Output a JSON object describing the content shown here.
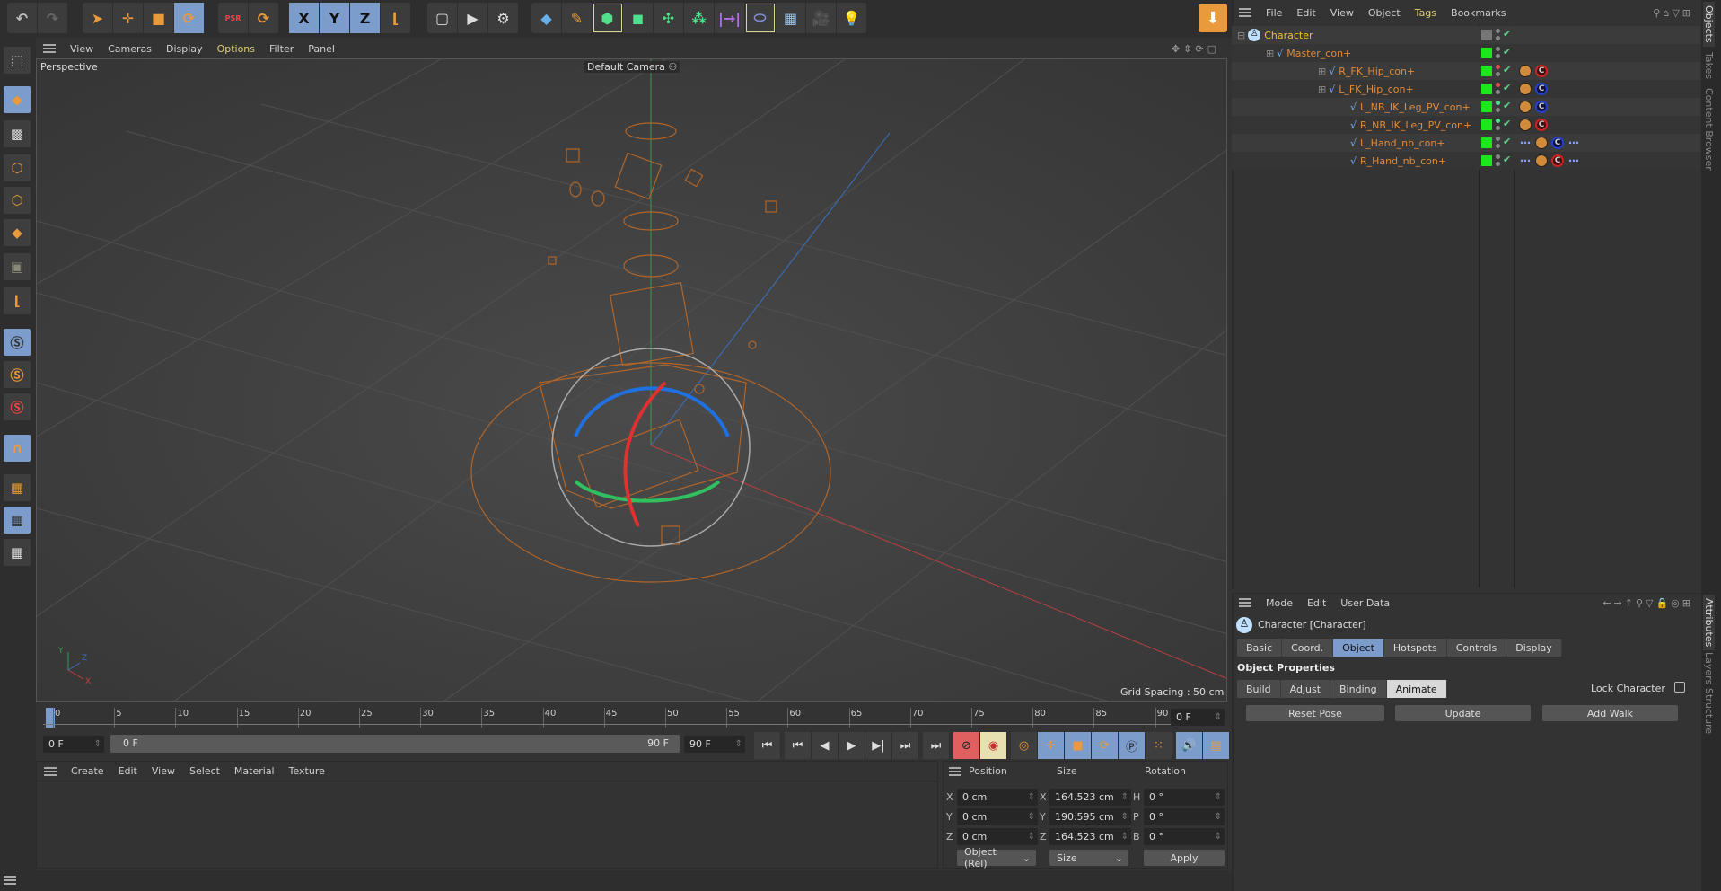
{
  "toolbar": {
    "icons": [
      "undo-icon",
      "redo-icon",
      "select-icon",
      "move-icon",
      "scale-icon",
      "rotate-icon",
      "psr-icon",
      "recent-tool-icon",
      "x-axis-icon",
      "y-axis-icon",
      "z-axis-icon",
      "coordinate-system-icon",
      "render-view-icon",
      "render-picture-viewer-icon",
      "render-settings-icon",
      "cube-icon",
      "pen-icon",
      "subdivision-icon",
      "extrude-icon",
      "array-icon",
      "mograph-icon",
      "deformer-icon",
      "field-icon",
      "floor-icon",
      "camera-icon",
      "light-icon"
    ],
    "psr_label": "PSR",
    "x": "X",
    "y": "Y",
    "z": "Z"
  },
  "viewport": {
    "menu": [
      "View",
      "Cameras",
      "Display",
      "Options",
      "Filter",
      "Panel"
    ],
    "view_name": "Perspective",
    "camera": "Default Camera",
    "grid_spacing": "Grid Spacing : 50 cm",
    "axis_labels": {
      "x": "X",
      "y": "Y",
      "z": "Z"
    }
  },
  "timeline": {
    "ticks": [
      "0",
      "5",
      "10",
      "15",
      "20",
      "25",
      "30",
      "35",
      "40",
      "45",
      "50",
      "55",
      "60",
      "65",
      "70",
      "75",
      "80",
      "85",
      "90"
    ],
    "current_frame": "0 F",
    "start": "0 F",
    "range_start": "0 F",
    "range_end": "90 F",
    "end": "90 F"
  },
  "materials": {
    "menu": [
      "Create",
      "Edit",
      "View",
      "Select",
      "Material",
      "Texture"
    ]
  },
  "coords": {
    "headers": [
      "Position",
      "Size",
      "Rotation"
    ],
    "rows": [
      {
        "pl": "X",
        "p": "0 cm",
        "sl": "X",
        "s": "164.523 cm",
        "rl": "H",
        "r": "0 °"
      },
      {
        "pl": "Y",
        "p": "0 cm",
        "sl": "Y",
        "s": "190.595 cm",
        "rl": "P",
        "r": "0 °"
      },
      {
        "pl": "Z",
        "p": "0 cm",
        "sl": "Z",
        "s": "164.523 cm",
        "rl": "B",
        "r": "0 °"
      }
    ],
    "mode": "Object (Rel)",
    "size_mode": "Size",
    "apply": "Apply"
  },
  "objects": {
    "menu": [
      "File",
      "Edit",
      "View",
      "Object",
      "Tags",
      "Bookmarks"
    ],
    "items": [
      {
        "name": "Character",
        "level": 0
      },
      {
        "name": "Master_con+",
        "level": 1
      },
      {
        "name": "R_FK_Hip_con+",
        "level": 2
      },
      {
        "name": "L_FK_Hip_con+",
        "level": 2
      },
      {
        "name": "L_NB_IK_Leg_PV_con+",
        "level": 3
      },
      {
        "name": "R_NB_IK_Leg_PV_con+",
        "level": 3
      },
      {
        "name": "L_Hand_nb_con+",
        "level": 3
      },
      {
        "name": "R_Hand_nb_con+",
        "level": 3
      }
    ]
  },
  "right_tabs": {
    "top": [
      "Objects",
      "Takes",
      "Content Browser"
    ],
    "bottom": [
      "Attributes",
      "Layers",
      "Structure"
    ]
  },
  "attributes": {
    "menu": [
      "Mode",
      "Edit",
      "User Data"
    ],
    "object": "Character [Character]",
    "tabs": [
      "Basic",
      "Coord.",
      "Object",
      "Hotspots",
      "Controls",
      "Display"
    ],
    "active_tab": "Object",
    "section": "Object Properties",
    "subtabs": [
      "Build",
      "Adjust",
      "Binding",
      "Animate"
    ],
    "active_subtab": "Animate",
    "lock_label": "Lock Character",
    "lock_checked": false,
    "buttons": [
      "Reset Pose",
      "Update",
      "Add Walk"
    ]
  },
  "colors": {
    "accent": "#7c9ccc",
    "object_name": "#e08a3a",
    "enabled": "#1de81d"
  }
}
